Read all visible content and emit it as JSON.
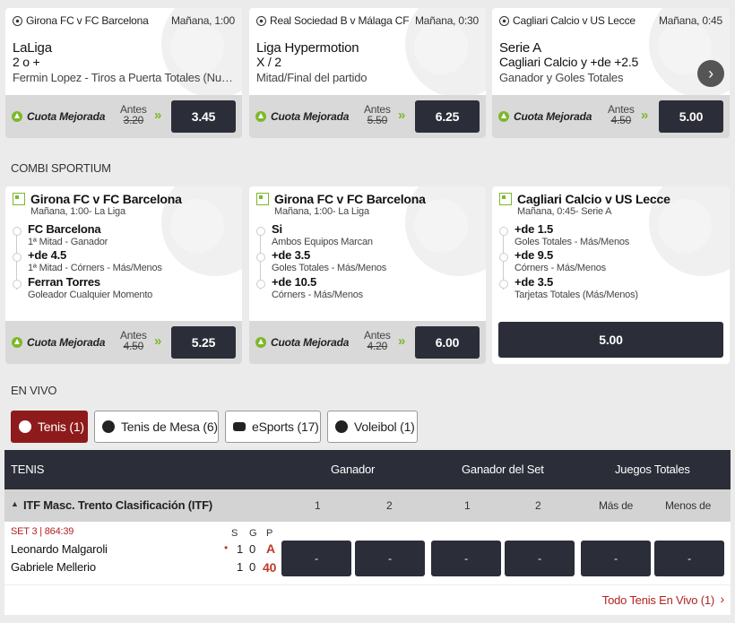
{
  "featured": [
    {
      "match": "Girona FC v FC Barcelona",
      "time": "Mañana, 1:00",
      "competition": "LaLiga",
      "selection": "2 o +",
      "description": "Fermin Lopez - Tiros a Puerta Totales (Nul…",
      "boost_label": "Cuota Mejorada",
      "before_label": "Antes",
      "old_odds": "3.20",
      "odds": "3.45"
    },
    {
      "match": "Real Sociedad B v Málaga CF",
      "time": "Mañana, 0:30",
      "competition": "Liga Hypermotion",
      "selection": "X / 2",
      "description": "Mitad/Final del partido",
      "boost_label": "Cuota Mejorada",
      "before_label": "Antes",
      "old_odds": "5.50",
      "odds": "6.25"
    },
    {
      "match": "Cagliari Calcio v US Lecce",
      "time": "Mañana, 0:45",
      "competition": "Serie A",
      "selection": "Cagliari Calcio y +de +2.5",
      "description": "Ganador y Goles Totales",
      "boost_label": "Cuota Mejorada",
      "before_label": "Antes",
      "old_odds": "4.50",
      "odds": "5.00"
    }
  ],
  "combi_title": "COMBI SPORTIUM",
  "combis": [
    {
      "match": "Girona FC v FC Barcelona",
      "sub": "Mañana, 1:00- La Liga",
      "legs": [
        {
          "name": "FC Barcelona",
          "market": "1ª Mitad - Ganador"
        },
        {
          "name": "+de 4.5",
          "market": "1ª Mitad - Córners - Más/Menos"
        },
        {
          "name": "Ferran Torres",
          "market": "Goleador Cualquier Momento"
        }
      ],
      "boost_label": "Cuota Mejorada",
      "before_label": "Antes",
      "old_odds": "4.50",
      "odds": "5.25"
    },
    {
      "match": "Girona FC v FC Barcelona",
      "sub": "Mañana, 1:00- La Liga",
      "legs": [
        {
          "name": "Si",
          "market": "Ambos Equipos Marcan"
        },
        {
          "name": "+de 3.5",
          "market": "Goles Totales - Más/Menos"
        },
        {
          "name": "+de 10.5",
          "market": "Córners - Más/Menos"
        }
      ],
      "boost_label": "Cuota Mejorada",
      "before_label": "Antes",
      "old_odds": "4.20",
      "odds": "6.00"
    },
    {
      "match": "Cagliari Calcio v US Lecce",
      "sub": "Mañana, 0:45- Serie A",
      "legs": [
        {
          "name": "+de 1.5",
          "market": "Goles Totales - Más/Menos"
        },
        {
          "name": "+de 9.5",
          "market": "Córners - Más/Menos"
        },
        {
          "name": "+de 3.5",
          "market": "Tarjetas Totales (Más/Menos)"
        }
      ],
      "odds": "5.00"
    }
  ],
  "live_title": "EN VIVO",
  "tabs": [
    {
      "label": "Tenis (1)",
      "icon": "tennis-ball-icon"
    },
    {
      "label": "Tenis de Mesa (6)",
      "icon": "table-tennis-icon"
    },
    {
      "label": "eSports (17)",
      "icon": "gamepad-icon"
    },
    {
      "label": "Voleibol (1)",
      "icon": "volleyball-icon"
    }
  ],
  "table": {
    "sport": "TENIS",
    "col_winner": "Ganador",
    "col_set": "Ganador del Set",
    "col_games": "Juegos Totales",
    "tournament": "ITF Masc. Trento Clasificación (ITF)",
    "sub": {
      "w1": "1",
      "w2": "2",
      "s1": "1",
      "s2": "2",
      "over": "Más de",
      "under": "Menos de"
    },
    "status": "SET 3 | 864:39",
    "score_headers": {
      "s": "S",
      "g": "G",
      "p": "P"
    },
    "players": [
      {
        "name": "Leonardo Malgaroli",
        "s": "1",
        "g": "0",
        "p": "A",
        "serving": "•"
      },
      {
        "name": "Gabriele Mellerio",
        "s": "1",
        "g": "0",
        "p": "40"
      }
    ],
    "dash": "-",
    "all_link": "Todo Tenis En Vivo (1)"
  }
}
